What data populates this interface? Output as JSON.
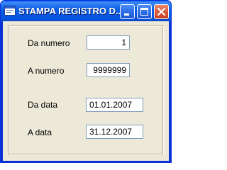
{
  "window": {
    "title": "STAMPA REGISTRO D..."
  },
  "icons": {
    "app": "window-app-icon",
    "minimize": "minimize-icon",
    "maximize": "maximize-icon",
    "close": "close-icon"
  },
  "colors": {
    "titlebar": "#0b5fe8",
    "client_bg": "#ece9d8",
    "field_border": "#7f9db9",
    "close_button": "#dd5c3a"
  },
  "form": {
    "from_number": {
      "label": "Da numero",
      "value": "1"
    },
    "to_number": {
      "label": "A  numero",
      "value": "9999999"
    },
    "from_date": {
      "label": "Da data",
      "value": "01.01.2007"
    },
    "to_date": {
      "label": "A  data",
      "value": "31.12.2007"
    }
  }
}
